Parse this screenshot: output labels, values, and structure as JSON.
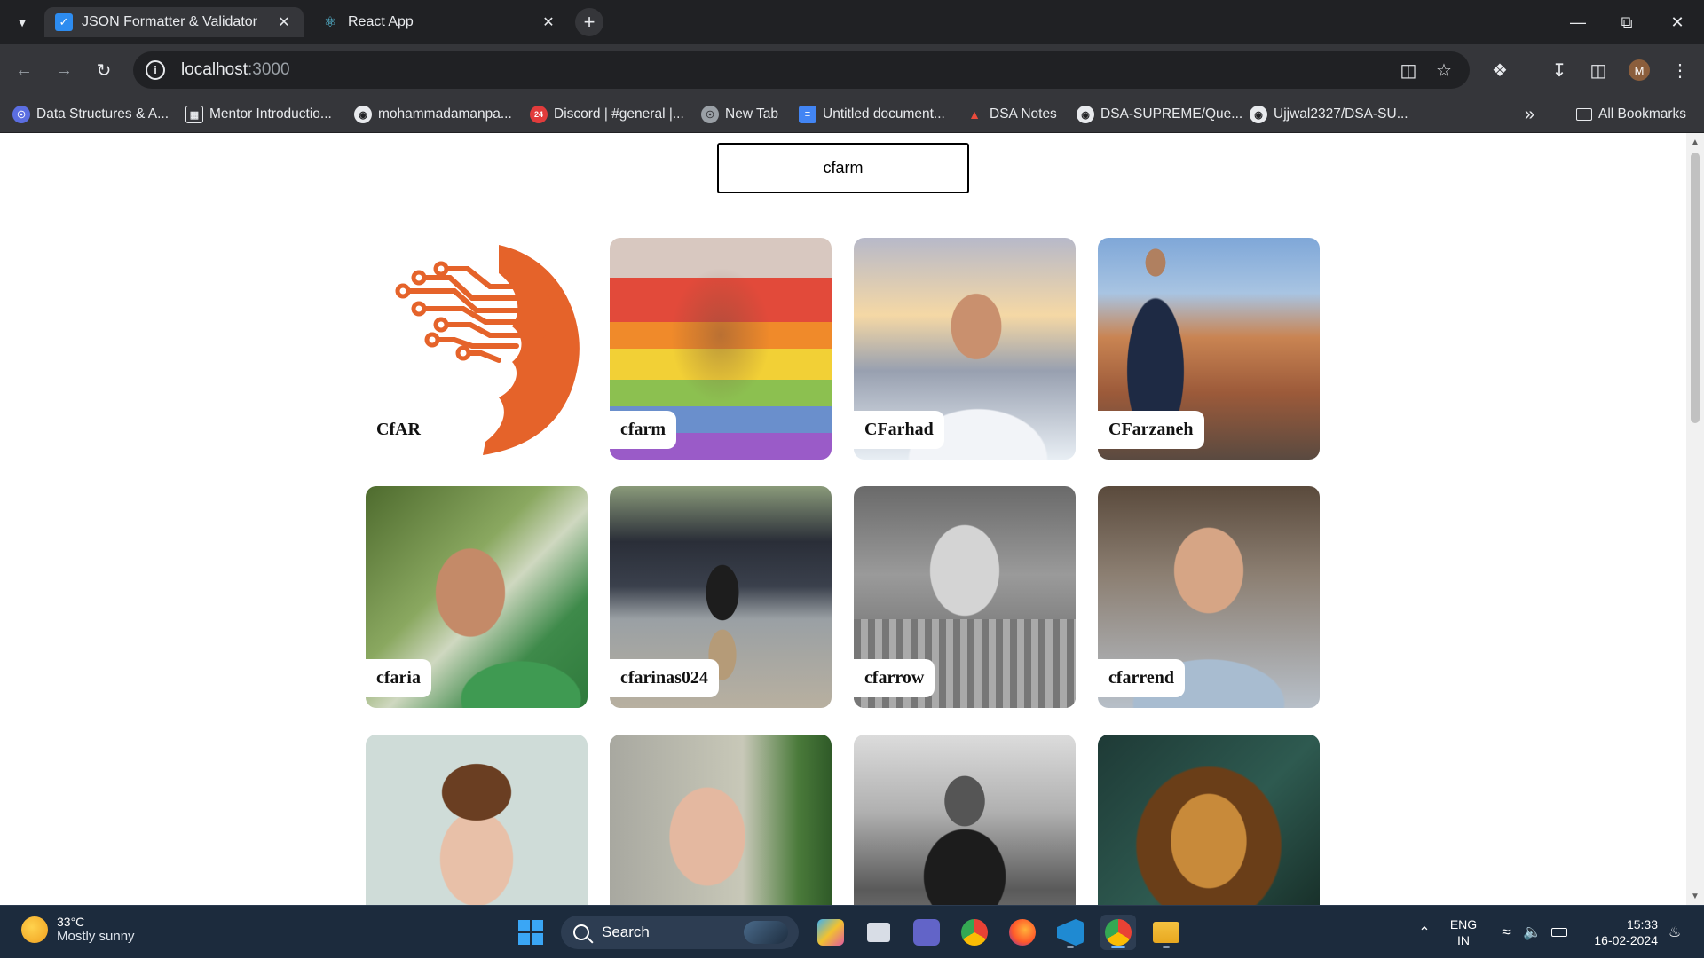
{
  "browser": {
    "tabs": [
      {
        "title": "JSON Formatter & Validator",
        "active": true
      },
      {
        "title": "React App",
        "active": false
      }
    ],
    "url_host": "localhost",
    "url_port": ":3000",
    "bookmarks": [
      "Data Structures & A...",
      "Mentor Introductio...",
      "mohammadamanpa...",
      "Discord | #general |...",
      "New Tab",
      "Untitled document...",
      "DSA Notes",
      "DSA-SUPREME/Que...",
      "Ujjwal2327/DSA-SU..."
    ],
    "all_bookmarks": "All Bookmarks",
    "profile_initial": "M",
    "discord_badge": "24"
  },
  "app": {
    "search_value": "cfarm",
    "users": [
      {
        "login": "CfAR"
      },
      {
        "login": "cfarm"
      },
      {
        "login": "CFarhad"
      },
      {
        "login": "CFarzaneh"
      },
      {
        "login": "cfaria"
      },
      {
        "login": "cfarinas024"
      },
      {
        "login": "cfarrow"
      },
      {
        "login": "cfarrend"
      },
      {
        "login": ""
      },
      {
        "login": ""
      },
      {
        "login": ""
      },
      {
        "login": ""
      }
    ]
  },
  "taskbar": {
    "temperature": "33°C",
    "weather": "Mostly sunny",
    "search_label": "Search",
    "lang1": "ENG",
    "lang2": "IN",
    "time": "15:33",
    "date": "16-02-2024"
  }
}
